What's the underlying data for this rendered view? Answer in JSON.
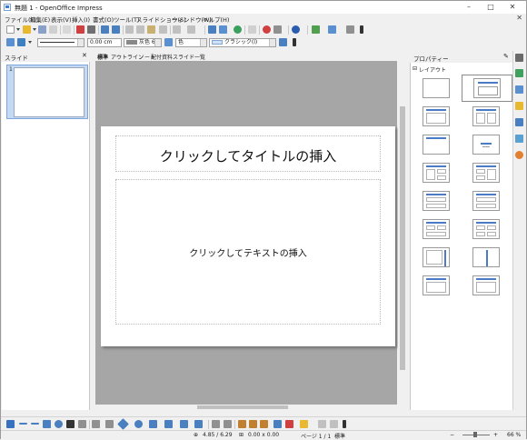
{
  "window": {
    "title": "無題 1 - OpenOffice Impress",
    "minimize": "–",
    "maximize": "□",
    "close": "✕"
  },
  "menu": [
    "ファイル(F)",
    "編集(E)",
    "表示(V)",
    "挿入(I)",
    "書式(O)",
    "ツール(T)",
    "スライドショー(S)",
    "ウィンドウ(W)",
    "ヘルプ(H)"
  ],
  "menu_close": "✕",
  "line_toolbar": {
    "width_value": "0.00 cm",
    "line_color": "灰色 6",
    "fill_color": "色",
    "style": "クラシック(l)"
  },
  "slides_pane": {
    "title": "スライド",
    "close": "✕",
    "slide_number": "1"
  },
  "view_tabs": [
    "標準",
    "アウトライン",
    "ノート",
    "配付資料",
    "スライド一覧"
  ],
  "slide": {
    "title_placeholder": "クリックしてタイトルの挿入",
    "text_placeholder": "クリックしてテキストの挿入"
  },
  "properties": {
    "title": "プロパティー",
    "tool": "✎",
    "section": "レイアウト",
    "collapse": "⊟"
  },
  "status": {
    "position": "4.85 / 6.29",
    "size": "0.00 x 0.00",
    "page": "ページ 1 / 1",
    "master": "標準",
    "zoom": "66 %",
    "zoom_level": 0.66
  },
  "colors": {
    "accent": "#3e7cc8",
    "layout_title_bar": "#4a7bc4",
    "canvas_bg": "#a6a6a6"
  }
}
